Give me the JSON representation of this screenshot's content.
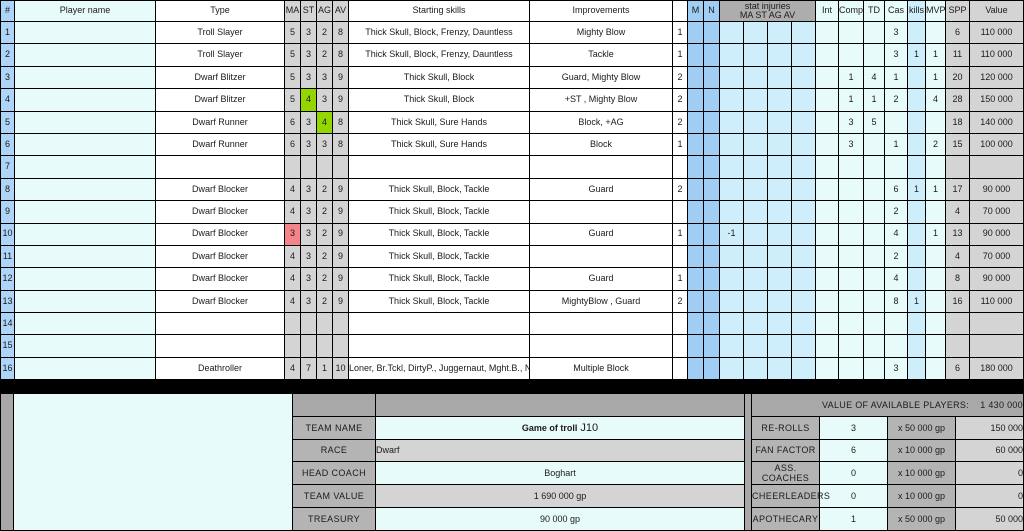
{
  "columns": {
    "num": "#",
    "player_name": "Player name",
    "type": "Type",
    "ma": "MA",
    "st": "ST",
    "ag": "AG",
    "av": "AV",
    "starting_skills": "Starting skills",
    "improvements": "Improvements",
    "m": "M",
    "n": "N",
    "stat_injuries": "stat injuries",
    "stat_injuries_sub": "MA ST AG AV",
    "int": "Int",
    "comp": "Comp",
    "td": "TD",
    "cas": "Cas",
    "kills": "kills",
    "mvp": "MVP",
    "spp": "SPP",
    "value": "Value"
  },
  "rows": [
    {
      "num": "1",
      "name": "",
      "type": "Troll Slayer",
      "ma": "5",
      "st": "3",
      "ag": "2",
      "av": "8",
      "skills": "Thick Skull,  Block,  Frenzy,  Dauntless",
      "impr": "Mighty Blow",
      "ni": "1",
      "si": [
        "",
        "",
        "",
        ""
      ],
      "int": "",
      "comp": "",
      "td": "",
      "cas": "3",
      "kills": "",
      "mvp": "",
      "spp": "6",
      "value": "110 000"
    },
    {
      "num": "2",
      "name": "",
      "type": "Troll Slayer",
      "ma": "5",
      "st": "3",
      "ag": "2",
      "av": "8",
      "skills": "Thick Skull,  Block,  Frenzy,  Dauntless",
      "impr": "Tackle",
      "ni": "1",
      "si": [
        "",
        "",
        "",
        ""
      ],
      "int": "",
      "comp": "",
      "td": "",
      "cas": "3",
      "kills": "1",
      "mvp": "1",
      "spp": "11",
      "value": "110 000"
    },
    {
      "num": "3",
      "name": "",
      "type": "Dwarf Blitzer",
      "ma": "5",
      "st": "3",
      "ag": "3",
      "av": "9",
      "skills": "Thick Skull,  Block",
      "impr": "Guard, Mighty Blow",
      "ni": "2",
      "si": [
        "",
        "",
        "",
        ""
      ],
      "int": "",
      "comp": "1",
      "td": "4",
      "cas": "1",
      "kills": "",
      "mvp": "1",
      "spp": "20",
      "value": "120 000"
    },
    {
      "num": "4",
      "name": "",
      "type": "Dwarf Blitzer",
      "ma": "5",
      "st": "4",
      "ag": "3",
      "av": "9",
      "st_up": true,
      "skills": "Thick Skull,  Block",
      "impr": "+ST , Mighty Blow",
      "ni": "2",
      "si": [
        "",
        "",
        "",
        ""
      ],
      "int": "",
      "comp": "1",
      "td": "1",
      "cas": "2",
      "kills": "",
      "mvp": "4",
      "spp": "28",
      "value": "150 000"
    },
    {
      "num": "5",
      "name": "",
      "type": "Dwarf Runner",
      "ma": "6",
      "st": "3",
      "ag": "4",
      "av": "8",
      "ag_up": true,
      "skills": "Thick Skull,  Sure Hands",
      "impr": "Block,  +AG",
      "ni": "2",
      "si": [
        "",
        "",
        "",
        ""
      ],
      "int": "",
      "comp": "3",
      "td": "5",
      "cas": "",
      "kills": "",
      "mvp": "",
      "spp": "18",
      "value": "140 000"
    },
    {
      "num": "6",
      "name": "",
      "type": "Dwarf Runner",
      "ma": "6",
      "st": "3",
      "ag": "3",
      "av": "8",
      "skills": "Thick Skull,  Sure Hands",
      "impr": "Block",
      "ni": "1",
      "si": [
        "",
        "",
        "",
        ""
      ],
      "int": "",
      "comp": "3",
      "td": "",
      "cas": "1",
      "kills": "",
      "mvp": "2",
      "spp": "15",
      "value": "100 000"
    },
    {
      "num": "7",
      "name": "",
      "type": "",
      "ma": "",
      "st": "",
      "ag": "",
      "av": "",
      "skills": "",
      "impr": "",
      "ni": "",
      "si": [
        "",
        "",
        "",
        ""
      ],
      "int": "",
      "comp": "",
      "td": "",
      "cas": "",
      "kills": "",
      "mvp": "",
      "spp": "",
      "value": ""
    },
    {
      "num": "8",
      "name": "",
      "type": "Dwarf Blocker",
      "ma": "4",
      "st": "3",
      "ag": "2",
      "av": "9",
      "skills": "Thick Skull,  Block,  Tackle",
      "impr": "Guard",
      "ni": "2",
      "si": [
        "",
        "",
        "",
        ""
      ],
      "int": "",
      "comp": "",
      "td": "",
      "cas": "6",
      "kills": "1",
      "mvp": "1",
      "spp": "17",
      "value": "90 000"
    },
    {
      "num": "9",
      "name": "",
      "type": "Dwarf Blocker",
      "ma": "4",
      "st": "3",
      "ag": "2",
      "av": "9",
      "skills": "Thick Skull,  Block,  Tackle",
      "impr": "",
      "ni": "",
      "si": [
        "",
        "",
        "",
        ""
      ],
      "int": "",
      "comp": "",
      "td": "",
      "cas": "2",
      "kills": "",
      "mvp": "",
      "spp": "4",
      "value": "70 000"
    },
    {
      "num": "10",
      "name": "",
      "type": "Dwarf Blocker",
      "ma": "3",
      "st": "3",
      "ag": "2",
      "av": "9",
      "ma_down": true,
      "skills": "Thick Skull,  Block,  Tackle",
      "impr": "Guard",
      "ni": "1",
      "si": [
        "-1",
        "",
        "",
        ""
      ],
      "int": "",
      "comp": "",
      "td": "",
      "cas": "4",
      "kills": "",
      "mvp": "1",
      "spp": "13",
      "value": "90 000"
    },
    {
      "num": "11",
      "name": "",
      "type": "Dwarf Blocker",
      "ma": "4",
      "st": "3",
      "ag": "2",
      "av": "9",
      "skills": "Thick Skull,  Block,  Tackle",
      "impr": "",
      "ni": "",
      "si": [
        "",
        "",
        "",
        ""
      ],
      "int": "",
      "comp": "",
      "td": "",
      "cas": "2",
      "kills": "",
      "mvp": "",
      "spp": "4",
      "value": "70 000"
    },
    {
      "num": "12",
      "name": "",
      "type": "Dwarf Blocker",
      "ma": "4",
      "st": "3",
      "ag": "2",
      "av": "9",
      "skills": "Thick Skull,  Block,  Tackle",
      "impr": "Guard",
      "ni": "1",
      "si": [
        "",
        "",
        "",
        ""
      ],
      "int": "",
      "comp": "",
      "td": "",
      "cas": "4",
      "kills": "",
      "mvp": "",
      "spp": "8",
      "value": "90 000"
    },
    {
      "num": "13",
      "name": "",
      "type": "Dwarf Blocker",
      "ma": "4",
      "st": "3",
      "ag": "2",
      "av": "9",
      "skills": "Thick Skull,  Block,  Tackle",
      "impr": "MightyBlow , Guard",
      "ni": "2",
      "si": [
        "",
        "",
        "",
        ""
      ],
      "int": "",
      "comp": "",
      "td": "",
      "cas": "8",
      "kills": "1",
      "mvp": "",
      "spp": "16",
      "value": "110 000"
    },
    {
      "num": "14",
      "name": "",
      "type": "",
      "ma": "",
      "st": "",
      "ag": "",
      "av": "",
      "skills": "",
      "impr": "",
      "ni": "",
      "si": [
        "",
        "",
        "",
        ""
      ],
      "int": "",
      "comp": "",
      "td": "",
      "cas": "",
      "kills": "",
      "mvp": "",
      "spp": "",
      "value": ""
    },
    {
      "num": "15",
      "name": "",
      "type": "",
      "ma": "",
      "st": "",
      "ag": "",
      "av": "",
      "skills": "",
      "impr": "",
      "ni": "",
      "si": [
        "",
        "",
        "",
        ""
      ],
      "int": "",
      "comp": "",
      "td": "",
      "cas": "",
      "kills": "",
      "mvp": "",
      "spp": "",
      "value": ""
    },
    {
      "num": "16",
      "name": "",
      "type": "Deathroller",
      "ma": "4",
      "st": "7",
      "ag": "1",
      "av": "10",
      "skills": "Loner, Br.Tckl, DirtyP., Juggernaut, Mght.B., No Hands, Secret Weapon, Stand Firm",
      "impr": "Multiple Block",
      "ni": "",
      "si": [
        "",
        "",
        "",
        ""
      ],
      "int": "",
      "comp": "",
      "td": "",
      "cas": "3",
      "kills": "",
      "mvp": "",
      "spp": "6",
      "value": "180 000"
    }
  ],
  "summary": {
    "value_of_available_players_label": "VALUE OF AVAILABLE PLAYERS:",
    "value_of_available_players": "1 430 000",
    "team_name_label": "TEAM NAME",
    "team_name": "Game of troll",
    "team_name_suffix": " J10",
    "race_label": "RACE",
    "race": "Dwarf",
    "head_coach_label": "HEAD COACH",
    "head_coach": "Boghart",
    "team_value_label": "TEAM VALUE",
    "team_value": "1 690 000  gp",
    "treasury_label": "TREASURY",
    "treasury": "90 000  gp"
  },
  "extras": [
    {
      "label": "RE-ROLLS",
      "count": "3",
      "mult": "x    50 000  gp",
      "total": "150 000"
    },
    {
      "label": "FAN FACTOR",
      "count": "6",
      "mult": "x    10 000  gp",
      "total": "60 000"
    },
    {
      "label": "ASS. COACHES",
      "count": "0",
      "mult": "x    10 000  gp",
      "total": "0"
    },
    {
      "label": "CHEERLEADERS",
      "count": "0",
      "mult": "x    10 000  gp",
      "total": "0"
    },
    {
      "label": "APOTHECARY",
      "count": "1",
      "mult": "x    50 000  gp",
      "total": "50 000"
    }
  ],
  "colors": {
    "header_grey": "#adadad",
    "row_number_blue": "#aed5f7",
    "stat_up_green": "#93d600",
    "stat_down_red": "#f4848a",
    "improvement_green": "#2f6b31",
    "m_n_blue": "#9fcdf3",
    "stat_injury_blue": "#cfeefb",
    "light_cyan": "#e8fbfb"
  }
}
